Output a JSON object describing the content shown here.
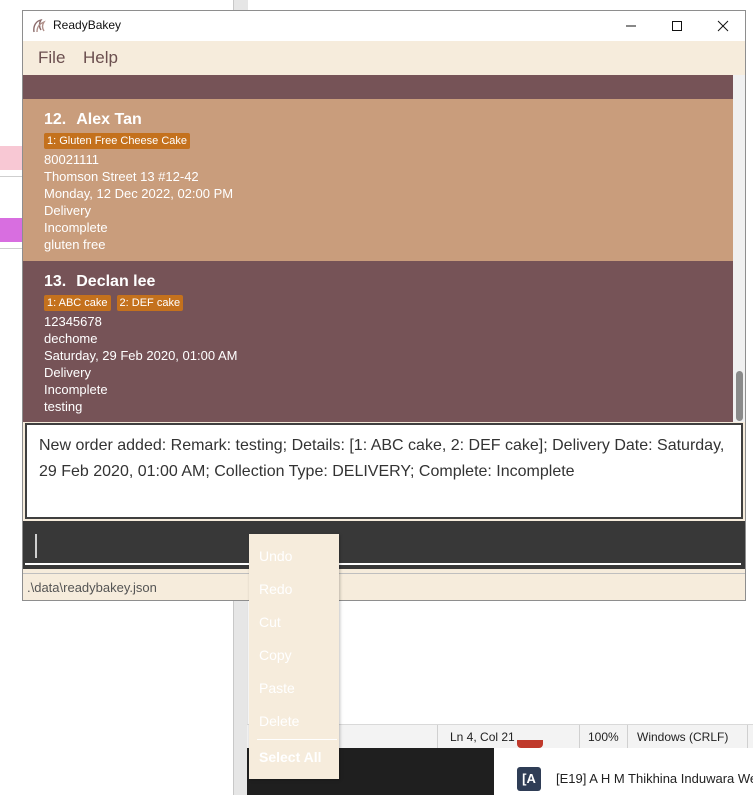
{
  "window": {
    "title": "ReadyBakey"
  },
  "menu": {
    "file": "File",
    "help": "Help"
  },
  "orders": [
    {
      "index": "12.",
      "name": "Alex Tan",
      "items": [
        "1: Gluten Free Cheese Cake"
      ],
      "phone": "80021111",
      "address": "Thomson Street 13 #12-42",
      "date": "Monday, 12 Dec 2022, 02:00 PM",
      "collection": "Delivery",
      "status": "Incomplete",
      "remark": "gluten free"
    },
    {
      "index": "13.",
      "name": "Declan lee",
      "items": [
        "1: ABC cake",
        "2: DEF cake"
      ],
      "phone": "12345678",
      "address": "dechome",
      "date": "Saturday, 29 Feb 2020, 01:00 AM",
      "collection": "Delivery",
      "status": "Incomplete",
      "remark": "testing"
    }
  ],
  "result": {
    "message": "New order added: Remark: testing; Details: [1: ABC cake, 2: DEF cake]; Delivery Date: Saturday, 29 Feb 2020, 01:00 AM; Collection Type: DELIVERY; Complete: Incomplete"
  },
  "command": {
    "value": ""
  },
  "status": {
    "path": ".\\data\\readybakey.json"
  },
  "context_menu": {
    "undo": "Undo",
    "redo": "Redo",
    "cut": "Cut",
    "copy": "Copy",
    "paste": "Paste",
    "delete": "Delete",
    "select_all": "Select All"
  },
  "background": {
    "editor_status": {
      "position": "Ln 4, Col 21",
      "zoom": "100%",
      "line_ending": "Windows (CRLF)"
    },
    "notification": {
      "badge": "[A",
      "text": "[E19] A H M Thikhina Induwara We"
    }
  },
  "colors": {
    "list_bg": "#765357",
    "card_alt_bg": "#c99d7c",
    "tag_bg": "#c4711d",
    "window_bg": "#f6ecdc",
    "command_bg": "#383838"
  }
}
